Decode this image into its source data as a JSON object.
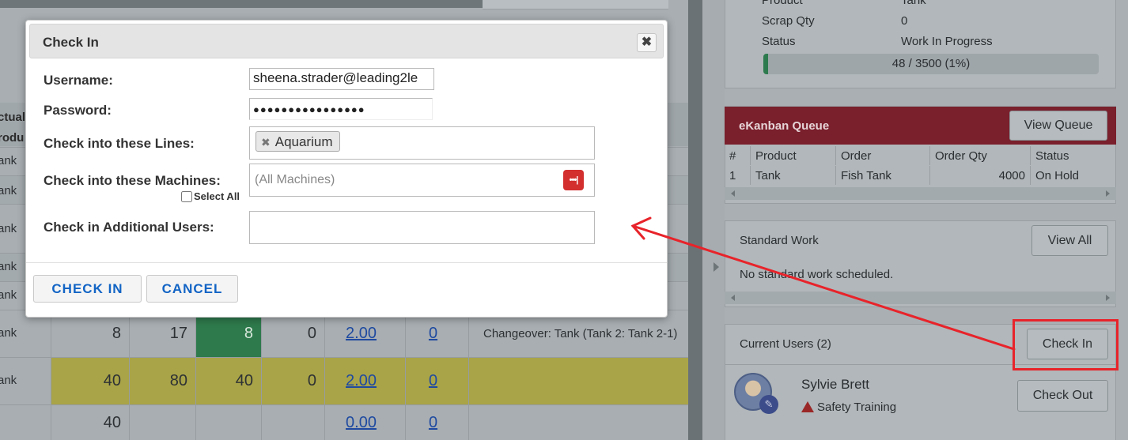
{
  "background_table": {
    "header_col": [
      "ctual",
      "rodu"
    ],
    "row_labels": [
      "ank",
      "ank",
      "ank",
      "ank",
      "ank",
      "ank",
      "ank"
    ],
    "rows": [
      {
        "label": "ank",
        "v1": "8",
        "v2": "17",
        "v3": "8",
        "v4": "0",
        "link1": "2.00",
        "link2": "0",
        "note": "Changeover: Tank (Tank 2: Tank 2-1)"
      },
      {
        "label": "ank",
        "v1": "40",
        "v2": "80",
        "v3": "40",
        "v4": "0",
        "link1": "2.00",
        "link2": "0",
        "note": ""
      },
      {
        "label": "",
        "v1": "40",
        "v2": "",
        "v3": "",
        "v4": "",
        "link1": "0.00",
        "link2": "0",
        "note": ""
      }
    ]
  },
  "right_panel": {
    "details": [
      {
        "key": "Product",
        "value": "Tank"
      },
      {
        "key": "Scrap Qty",
        "value": "0"
      },
      {
        "key": "Status",
        "value": "Work In Progress"
      }
    ],
    "progress": {
      "text": "48 / 3500 (1%)",
      "fraction": 0.014
    },
    "ekanban": {
      "title": "eKanban Queue",
      "button": "View Queue",
      "columns": [
        "#",
        "Product",
        "Order",
        "Order Qty",
        "Status"
      ],
      "rows": [
        {
          "num": "1",
          "product": "Tank",
          "order": "Fish Tank",
          "qty": "4000",
          "status": "On Hold"
        }
      ]
    },
    "standard_work": {
      "title": "Standard Work",
      "button": "View All",
      "empty_text": "No standard work scheduled."
    },
    "current_users": {
      "title": "Current Users (2)",
      "check_in_button": "Check In",
      "users": [
        {
          "name": "Sylvie Brett",
          "badge_text": "Safety Training",
          "check_out_button": "Check Out"
        }
      ]
    }
  },
  "modal": {
    "title": "Check In",
    "close_symbol": "✖",
    "labels": {
      "username": "Username:",
      "password": "Password:",
      "lines": "Check into these Lines:",
      "machines": "Check into these Machines:",
      "select_all": "Select All",
      "additional_users": "Check in Additional Users:"
    },
    "values": {
      "username": "sheena.strader@leading2le",
      "password": "●●●●●●●●●●●●●●●●",
      "lines_tag": "Aquarium",
      "machines_placeholder": "(All Machines)"
    },
    "buttons": {
      "check_in": "CHECK IN",
      "cancel": "CANCEL"
    }
  },
  "annotation_colors": {
    "arrow": "#e8232a",
    "highlight_box": "#e8232a"
  }
}
